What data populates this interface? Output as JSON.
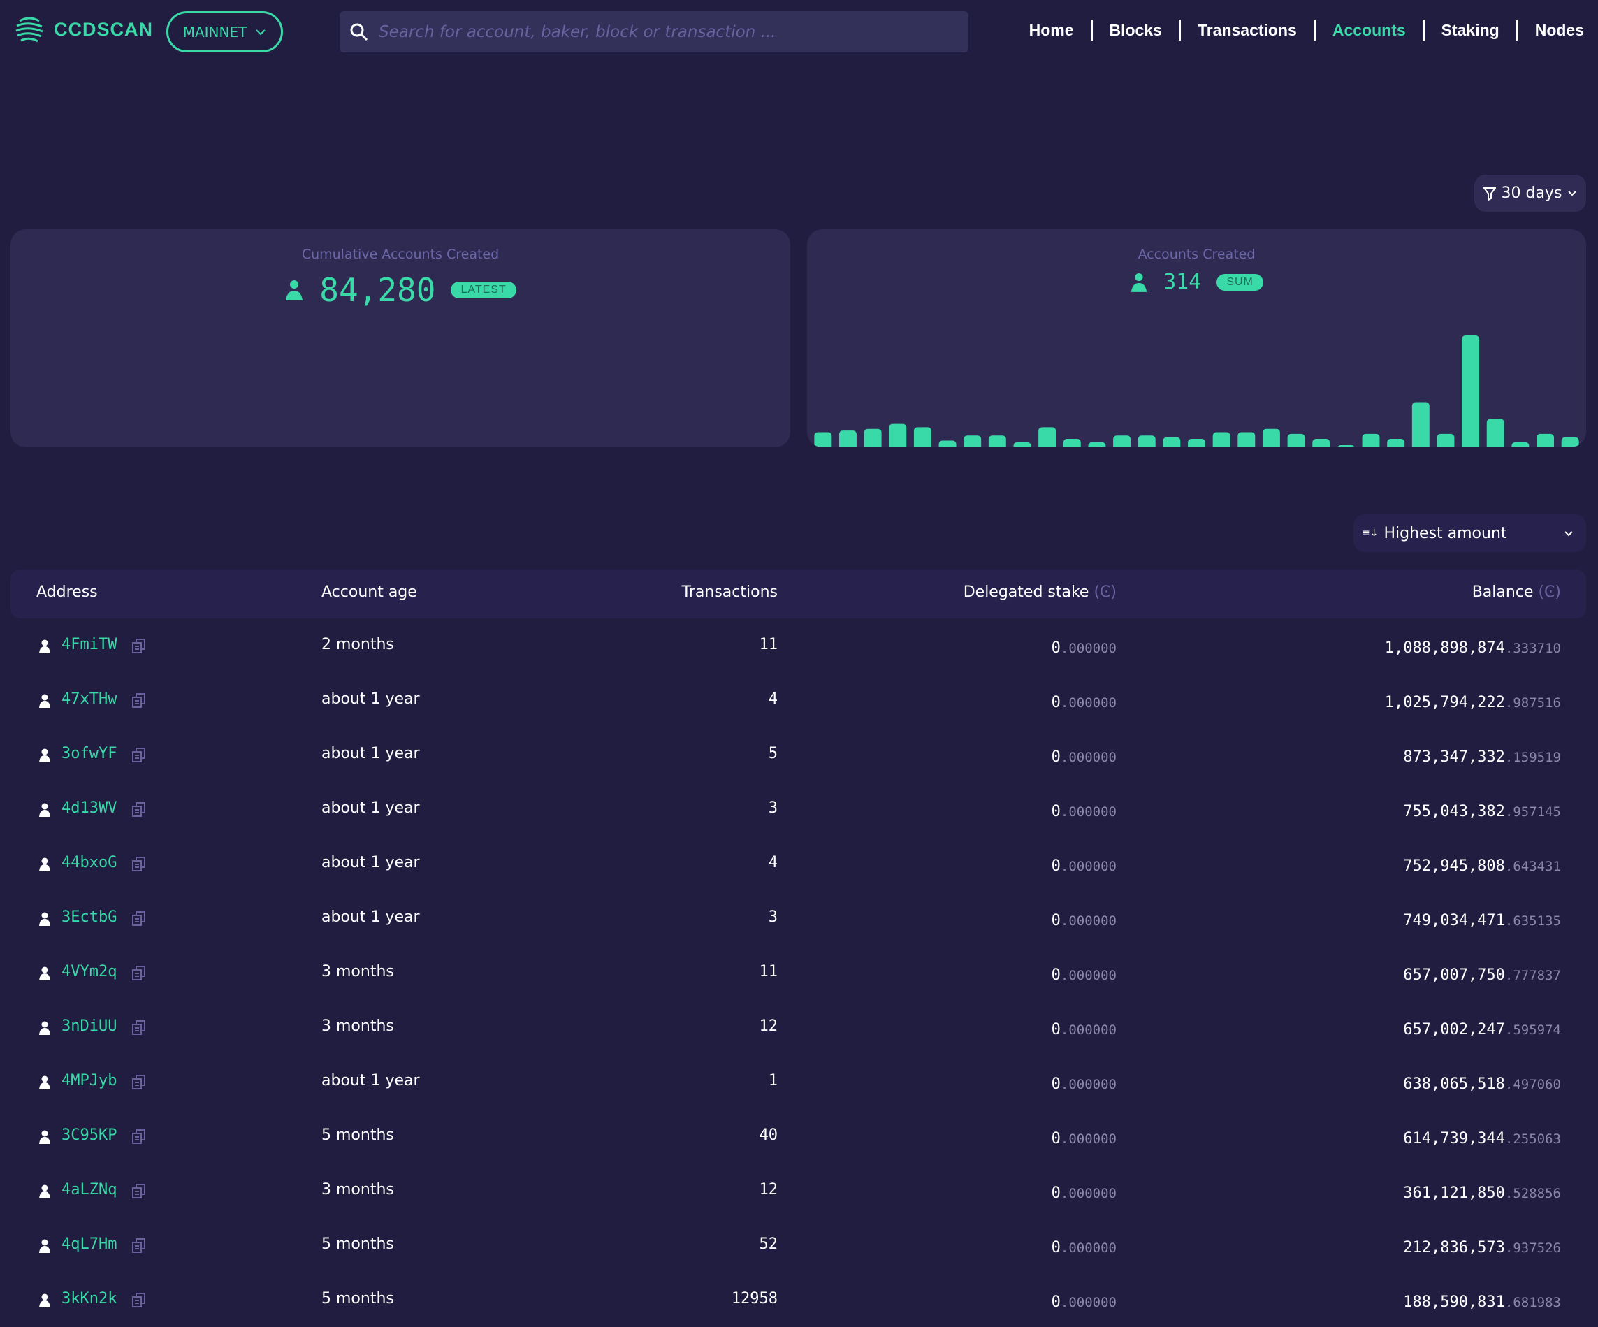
{
  "header": {
    "brand": "CCDSCAN",
    "network": "MAINNET",
    "search_placeholder": "Search for account, baker, block or transaction ...",
    "nav": [
      {
        "label": "Home",
        "active": false
      },
      {
        "label": "Blocks",
        "active": false
      },
      {
        "label": "Transactions",
        "active": false
      },
      {
        "label": "Accounts",
        "active": true
      },
      {
        "label": "Staking",
        "active": false
      },
      {
        "label": "Nodes",
        "active": false
      }
    ]
  },
  "filter": {
    "label": "30 days"
  },
  "cards": {
    "cumulative": {
      "title": "Cumulative Accounts Created",
      "value": "84,280",
      "badge": "LATEST"
    },
    "created": {
      "title": "Accounts Created",
      "value": "314",
      "badge": "SUM"
    }
  },
  "chart_data": {
    "type": "bar",
    "title": "Accounts Created",
    "values": [
      9,
      10,
      11,
      14,
      12,
      4,
      7,
      7,
      3,
      12,
      5,
      3,
      7,
      7,
      6,
      5,
      9,
      9,
      11,
      8,
      5,
      1,
      8,
      5,
      27,
      8,
      67,
      17,
      3,
      8,
      6
    ],
    "color": "#39d9a8"
  },
  "sort": {
    "label": "Highest amount"
  },
  "table": {
    "headers": {
      "address": "Address",
      "age": "Account age",
      "transactions": "Transactions",
      "delegated": "Delegated stake",
      "balance": "Balance",
      "currency": "(Ͼ)"
    },
    "rows": [
      {
        "address": "4FmiTW",
        "age": "2 months",
        "tx": "11",
        "del_int": "0",
        "del_dec": ".000000",
        "bal_int": "1,088,898,874",
        "bal_dec": ".333710"
      },
      {
        "address": "47xTHw",
        "age": "about 1 year",
        "tx": "4",
        "del_int": "0",
        "del_dec": ".000000",
        "bal_int": "1,025,794,222",
        "bal_dec": ".987516"
      },
      {
        "address": "3ofwYF",
        "age": "about 1 year",
        "tx": "5",
        "del_int": "0",
        "del_dec": ".000000",
        "bal_int": "873,347,332",
        "bal_dec": ".159519"
      },
      {
        "address": "4d13WV",
        "age": "about 1 year",
        "tx": "3",
        "del_int": "0",
        "del_dec": ".000000",
        "bal_int": "755,043,382",
        "bal_dec": ".957145"
      },
      {
        "address": "44bxoG",
        "age": "about 1 year",
        "tx": "4",
        "del_int": "0",
        "del_dec": ".000000",
        "bal_int": "752,945,808",
        "bal_dec": ".643431"
      },
      {
        "address": "3EctbG",
        "age": "about 1 year",
        "tx": "3",
        "del_int": "0",
        "del_dec": ".000000",
        "bal_int": "749,034,471",
        "bal_dec": ".635135"
      },
      {
        "address": "4VYm2q",
        "age": "3 months",
        "tx": "11",
        "del_int": "0",
        "del_dec": ".000000",
        "bal_int": "657,007,750",
        "bal_dec": ".777837"
      },
      {
        "address": "3nDiUU",
        "age": "3 months",
        "tx": "12",
        "del_int": "0",
        "del_dec": ".000000",
        "bal_int": "657,002,247",
        "bal_dec": ".595974"
      },
      {
        "address": "4MPJyb",
        "age": "about 1 year",
        "tx": "1",
        "del_int": "0",
        "del_dec": ".000000",
        "bal_int": "638,065,518",
        "bal_dec": ".497060"
      },
      {
        "address": "3C95KP",
        "age": "5 months",
        "tx": "40",
        "del_int": "0",
        "del_dec": ".000000",
        "bal_int": "614,739,344",
        "bal_dec": ".255063"
      },
      {
        "address": "4aLZNq",
        "age": "3 months",
        "tx": "12",
        "del_int": "0",
        "del_dec": ".000000",
        "bal_int": "361,121,850",
        "bal_dec": ".528856"
      },
      {
        "address": "4qL7Hm",
        "age": "5 months",
        "tx": "52",
        "del_int": "0",
        "del_dec": ".000000",
        "bal_int": "212,836,573",
        "bal_dec": ".937526"
      },
      {
        "address": "3kKn2k",
        "age": "5 months",
        "tx": "12958",
        "del_int": "0",
        "del_dec": ".000000",
        "bal_int": "188,590,831",
        "bal_dec": ".681983"
      }
    ]
  }
}
